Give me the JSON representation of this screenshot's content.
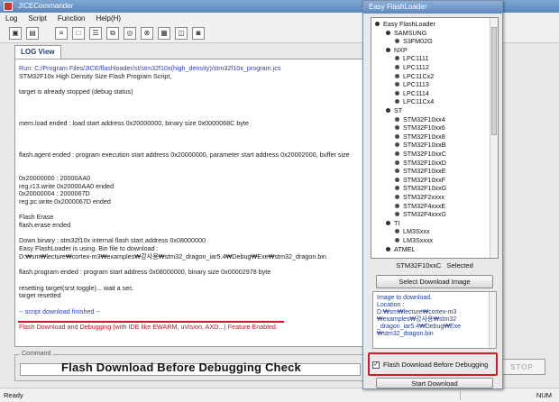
{
  "main_window": {
    "title": "JICECommander",
    "menu": [
      "Log",
      "Script",
      "Function",
      "Help(H)"
    ],
    "toolbar_icons": [
      "save-icon",
      "open-icon",
      "text-icon",
      "window-icon",
      "list-icon",
      "copy-icon",
      "target-icon",
      "stop-icon",
      "grid-icon",
      "view-icon",
      "camera-icon"
    ],
    "tab_label": "LOG View",
    "log_lines": [
      {
        "text": "Run: C:/Program Files/JICE/flashloader/st/stm32f10x(high_density)/stm32f10x_program.jcs",
        "style": "blue"
      },
      {
        "text": "STM32F10x High Density Size Flash Program Script,",
        "style": ""
      },
      {
        "text": "",
        "style": ""
      },
      {
        "text": "target is already stopped (debug status)",
        "style": ""
      },
      {
        "text": "",
        "style": ""
      },
      {
        "text": "",
        "style": ""
      },
      {
        "text": "",
        "style": ""
      },
      {
        "text": "mem.load ended : load start address 0x20000000, binary size 0x0000068C byte",
        "style": ""
      },
      {
        "text": "",
        "style": ""
      },
      {
        "text": "",
        "style": ""
      },
      {
        "text": "",
        "style": ""
      },
      {
        "text": "flash.agent ended : program execution start address 0x20000000, parameter start address 0x20002000, buffer size",
        "style": ""
      },
      {
        "text": "",
        "style": ""
      },
      {
        "text": "",
        "style": ""
      },
      {
        "text": "0x20000000 :      20000AA0",
        "style": ""
      },
      {
        "text": "reg.r13.write 0x20000AA0 ended",
        "style": ""
      },
      {
        "text": "0x20000004 :      2000067D",
        "style": ""
      },
      {
        "text": "reg.pc.write 0x2000067D ended",
        "style": ""
      },
      {
        "text": "",
        "style": ""
      },
      {
        "text": "Flash Erase",
        "style": ""
      },
      {
        "text": "flash.erase ended",
        "style": ""
      },
      {
        "text": "",
        "style": ""
      },
      {
        "text": "Down binary : stm32f10x internal flash start address 0x08000000",
        "style": ""
      },
      {
        "text": "Easy FlashLoader is using. Bin file to download :",
        "style": ""
      },
      {
        "text": "D:₩sm₩lecture₩cortex-m3₩examples₩강사용₩stm32_dragon_iar5.4₩Debug₩Exe₩stm32_dragon.bin",
        "style": ""
      },
      {
        "text": "",
        "style": ""
      },
      {
        "text": "flash.program ended : program start address 0x08000000, binary size 0x00002978 byte",
        "style": ""
      },
      {
        "text": "",
        "style": ""
      },
      {
        "text": "resetting target(srst toggle)... wait a sec.",
        "style": ""
      },
      {
        "text": "target resetted",
        "style": ""
      },
      {
        "text": "",
        "style": ""
      },
      {
        "text": "-- script download finished --",
        "style": "blue"
      },
      {
        "text": "",
        "style": ""
      },
      {
        "text": "Flash Download and Debugging (with IDE like EWARM, uVision, AXD...) Feature Enabled.",
        "style": "red"
      }
    ],
    "command_label": "Command",
    "caption": "Flash Download Before Debugging Check",
    "stop_label": "STOP",
    "status_left": "Ready",
    "status_right": "NUM"
  },
  "flashloader": {
    "title": "Easy FlashLoader",
    "tree": [
      {
        "label": "Easy FlashLoader",
        "level": 0,
        "cat": true
      },
      {
        "label": "SAMSUNG",
        "level": 1,
        "cat": true
      },
      {
        "label": "S3FM02G",
        "level": 2,
        "cat": false
      },
      {
        "label": "NXP",
        "level": 1,
        "cat": true
      },
      {
        "label": "LPC1111",
        "level": 2,
        "cat": false
      },
      {
        "label": "LPC1112",
        "level": 2,
        "cat": false
      },
      {
        "label": "LPC11Cx2",
        "level": 2,
        "cat": false
      },
      {
        "label": "LPC1113",
        "level": 2,
        "cat": false
      },
      {
        "label": "LPC1114",
        "level": 2,
        "cat": false
      },
      {
        "label": "LPC11Cx4",
        "level": 2,
        "cat": false
      },
      {
        "label": "ST",
        "level": 1,
        "cat": true
      },
      {
        "label": "STM32F10xx4",
        "level": 2,
        "cat": false
      },
      {
        "label": "STM32F10xx6",
        "level": 2,
        "cat": false
      },
      {
        "label": "STM32F10xx8",
        "level": 2,
        "cat": false
      },
      {
        "label": "STM32F10xxB",
        "level": 2,
        "cat": false
      },
      {
        "label": "STM32F10xxC",
        "level": 2,
        "cat": false
      },
      {
        "label": "STM32F10xxD",
        "level": 2,
        "cat": false
      },
      {
        "label": "STM32F10xxE",
        "level": 2,
        "cat": false
      },
      {
        "label": "STM32F10xxF",
        "level": 2,
        "cat": false
      },
      {
        "label": "STM32F10xxG",
        "level": 2,
        "cat": false
      },
      {
        "label": "STM32F2xxxx",
        "level": 2,
        "cat": false
      },
      {
        "label": "STM32F4xxxE",
        "level": 2,
        "cat": false
      },
      {
        "label": "STM32F4xxxG",
        "level": 2,
        "cat": false
      },
      {
        "label": "TI",
        "level": 1,
        "cat": true
      },
      {
        "label": "LM3Sxxx",
        "level": 2,
        "cat": false
      },
      {
        "label": "LM3Sxxxx",
        "level": 2,
        "cat": false
      },
      {
        "label": "ATMEL",
        "level": 1,
        "cat": true
      }
    ],
    "selected_device": "STM32F10xxC",
    "selected_word": "Selected",
    "select_image_label": "Select Download Image",
    "info_lines": [
      "Image to download.",
      "Location :",
      "D:₩sm₩lecture₩cortex-m3",
      "₩examples₩강사용₩stm32",
      "_dragon_iar5.4₩Debug₩Exe",
      "₩stm32_dragon.bin"
    ],
    "checkbox_label": "Flash Download Before Debugging",
    "checkbox_checked": true,
    "start_label": "Start Download"
  },
  "colors": {
    "highlight_red": "#d41928",
    "log_blue": "#2d3fb6",
    "log_red": "#c0142a"
  }
}
